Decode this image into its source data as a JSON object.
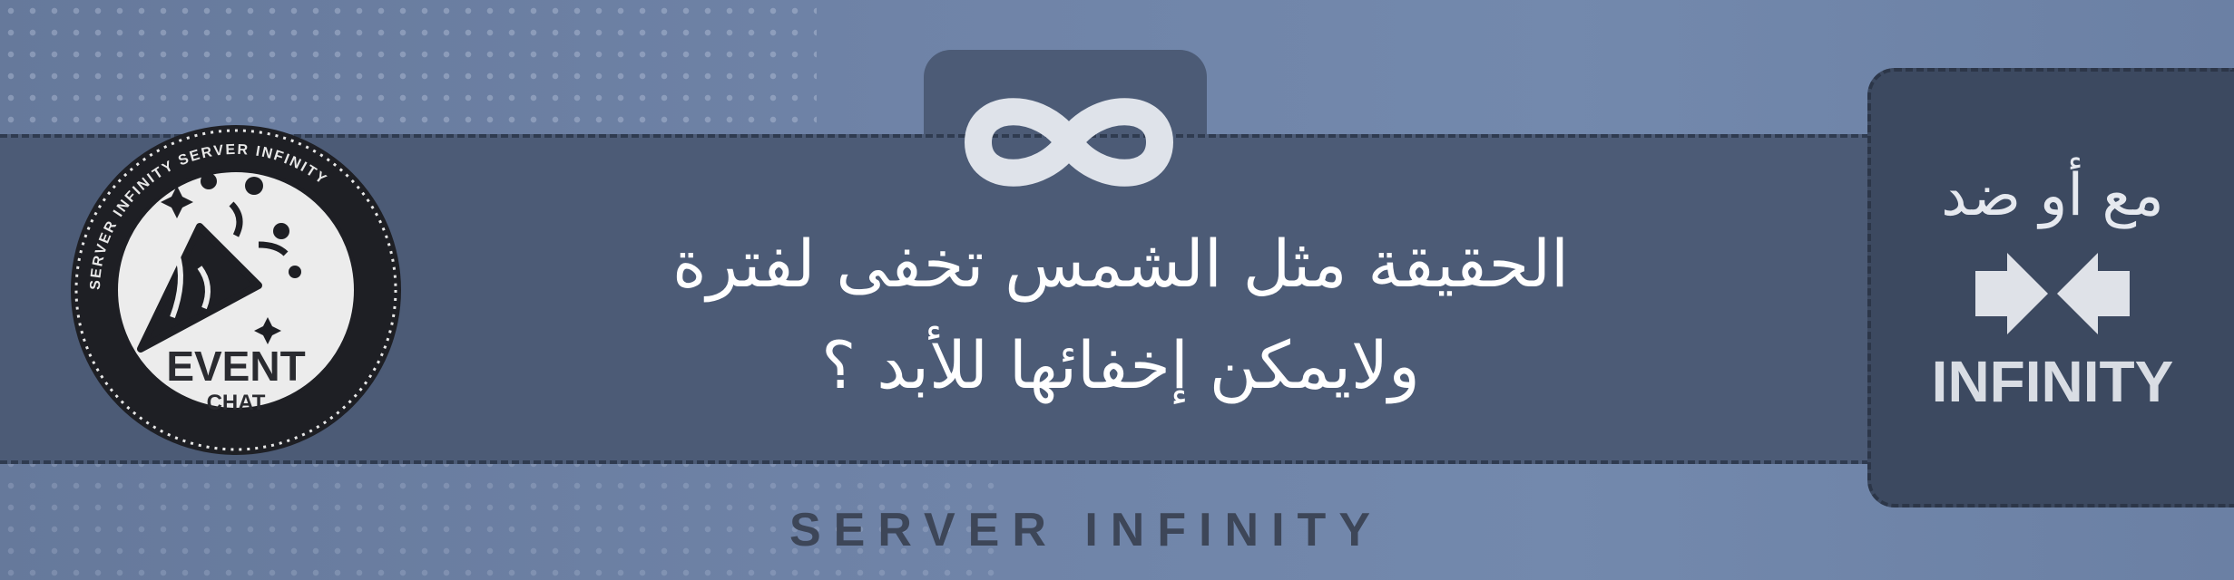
{
  "headline": {
    "line1": "الحقيقة مثل الشمس تخفى لفترة",
    "line2": "ولايمكن إخفائها للأبد ؟"
  },
  "badge": {
    "title": "EVENT",
    "subtitle": "CHAT",
    "ring_text": "SERVER INFINITY SERVER INFINITY"
  },
  "side_panel": {
    "arabic_label": "مع أو ضد",
    "brand": "INFINITY"
  },
  "footer": {
    "text": "SERVER  INFINITY"
  },
  "icons": {
    "top": "infinity-icon",
    "badge": "party-popper-icon",
    "panel": "inward-arrows-icon"
  },
  "colors": {
    "background": "#6b7ea1",
    "band": "#4c5b76",
    "panel": "#3c4960",
    "text": "#ffffff"
  }
}
